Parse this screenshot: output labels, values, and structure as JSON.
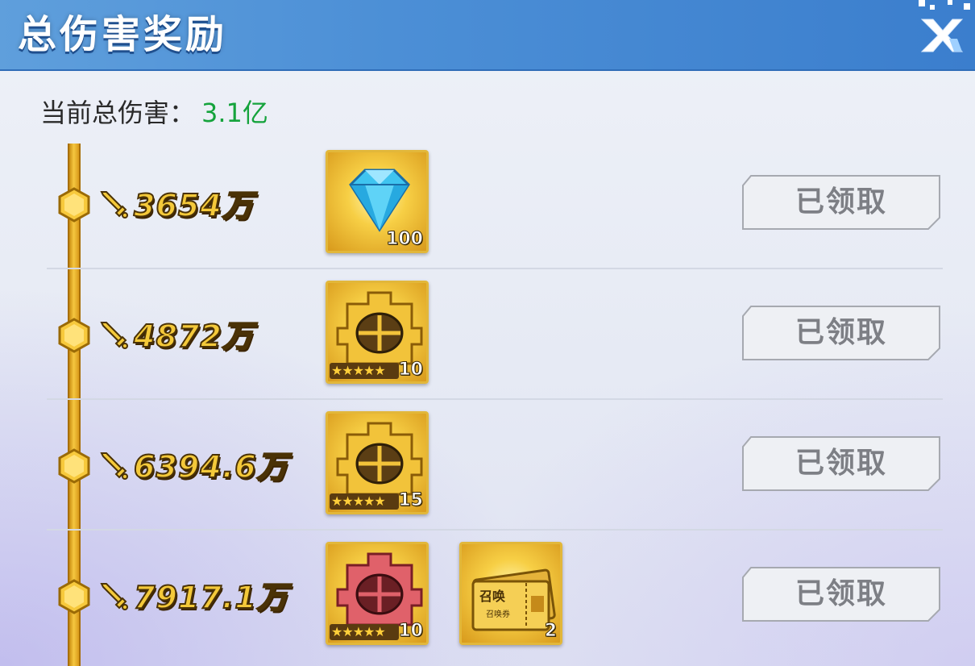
{
  "header": {
    "title": "总伤害奖励",
    "close_icon": "close-x-icon"
  },
  "summary": {
    "label": "当前总伤害：",
    "value": "3.1亿",
    "value_color": "#15a33c"
  },
  "rewards": [
    {
      "threshold": "3654万",
      "items": [
        {
          "icon": "diamond-icon",
          "count": "100",
          "stars": ""
        }
      ],
      "button_label": "已领取"
    },
    {
      "threshold": "4872万",
      "items": [
        {
          "icon": "gold-puzzle-fragment-icon",
          "count": "10",
          "stars": "★★★★★"
        }
      ],
      "button_label": "已领取"
    },
    {
      "threshold": "6394.6万",
      "items": [
        {
          "icon": "gold-puzzle-fragment-icon",
          "count": "15",
          "stars": "★★★★★"
        }
      ],
      "button_label": "已领取"
    },
    {
      "threshold": "7917.1万",
      "items": [
        {
          "icon": "red-puzzle-fragment-icon",
          "count": "10",
          "stars": "★★★★★"
        },
        {
          "icon": "summon-ticket-icon",
          "count": "2",
          "stars": "",
          "ticket_title": "召唤",
          "ticket_sub": "召唤券"
        }
      ],
      "button_label": "已领取"
    }
  ],
  "colors": {
    "header": "#4c8fd6",
    "timeline": "#f5c740",
    "threshold_text": "#f4c93a",
    "claimed_button_text": "#7d7f85"
  }
}
